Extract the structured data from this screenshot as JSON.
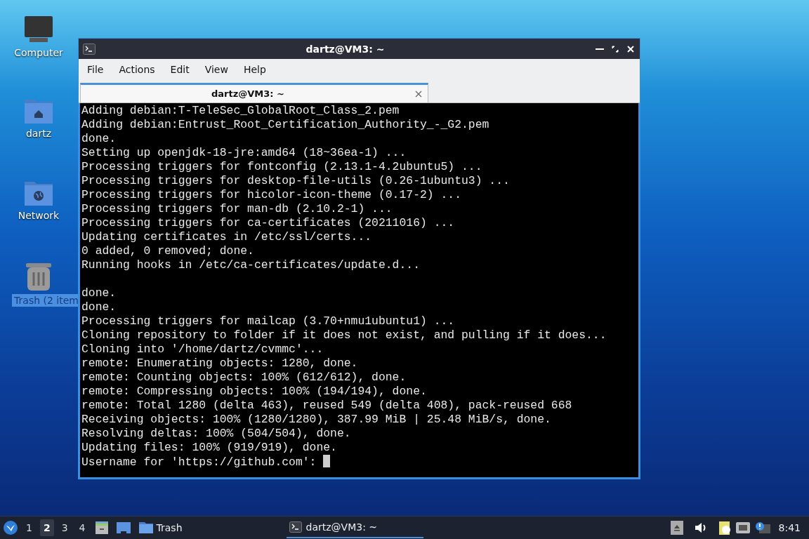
{
  "desktop_icons": [
    {
      "label": "Computer",
      "kind": "computer",
      "selected": false
    },
    {
      "label": "dartz",
      "kind": "home",
      "selected": false
    },
    {
      "label": "Network",
      "kind": "network",
      "selected": false
    },
    {
      "label": "Trash (2 item",
      "kind": "trash",
      "selected": true
    }
  ],
  "window": {
    "title": "dartz@VM3: ~",
    "menu": [
      "File",
      "Actions",
      "Edit",
      "View",
      "Help"
    ],
    "tabs": [
      {
        "label": "dartz@VM3: ~",
        "selected": true
      }
    ],
    "terminal": {
      "blocks": [
        [
          "Adding debian:T-TeleSec_GlobalRoot_Class_2.pem",
          "Adding debian:Entrust_Root_Certification_Authority_-_G2.pem",
          "done.",
          "Setting up openjdk-18-jre:amd64 (18~36ea-1) ...",
          "Processing triggers for fontconfig (2.13.1-4.2ubuntu5) ...",
          "Processing triggers for desktop-file-utils (0.26-1ubuntu3) ...",
          "Processing triggers for hicolor-icon-theme (0.17-2) ...",
          "Processing triggers for man-db (2.10.2-1) ...",
          "Processing triggers for ca-certificates (20211016) ...",
          "Updating certificates in /etc/ssl/certs...",
          "0 added, 0 removed; done.",
          "Running hooks in /etc/ca-certificates/update.d..."
        ],
        [
          "done.",
          "done.",
          "Processing triggers for mailcap (3.70+nmu1ubuntu1) ...",
          "Cloning repository to folder if it does not exist, and pulling if it does...",
          "Cloning into '/home/dartz/cvmmc'...",
          "remote: Enumerating objects: 1280, done.",
          "remote: Counting objects: 100% (612/612), done.",
          "remote: Compressing objects: 100% (194/194), done.",
          "remote: Total 1280 (delta 463), reused 549 (delta 408), pack-reused 668",
          "Receiving objects: 100% (1280/1280), 387.99 MiB | 25.48 MiB/s, done.",
          "Resolving deltas: 100% (504/504), done.",
          "Updating files: 100% (919/919), done."
        ]
      ],
      "prompt": "Username for 'https://github.com':"
    }
  },
  "taskbar": {
    "workspaces": [
      {
        "label": "1",
        "selected": false
      },
      {
        "label": "2",
        "selected": true
      },
      {
        "label": "3",
        "selected": false
      },
      {
        "label": "4",
        "selected": false
      }
    ],
    "launchers": [
      {
        "kind": "cabinet"
      },
      {
        "kind": "desktop"
      },
      {
        "kind": "folder",
        "label": "Trash"
      }
    ],
    "tasks": [
      {
        "label": "dartz@VM3: ~",
        "selected": true
      }
    ],
    "clock": "8:41"
  }
}
